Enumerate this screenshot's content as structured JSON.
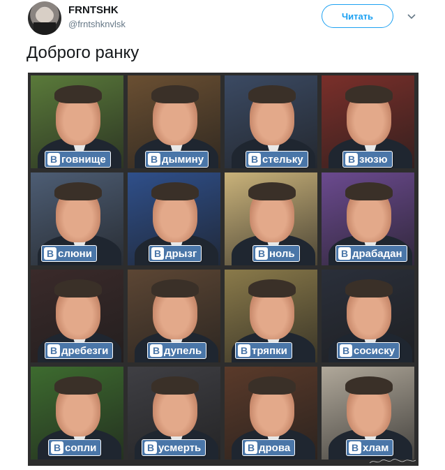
{
  "header": {
    "display_name": "FRNTSHK",
    "handle": "@frntshknvlsk",
    "follow_label": "Читать",
    "icons": {
      "avatar": "profile-photo",
      "menu": "chevron-down-icon"
    }
  },
  "tweet": {
    "text": "Доброго ранку"
  },
  "grid": {
    "badge_letter": "В",
    "badge_color": "#4a76a8",
    "tiles": [
      {
        "label": "говнище",
        "bg": "#5a7a3a"
      },
      {
        "label": "дымину",
        "bg": "#6a4f32"
      },
      {
        "label": "стельку",
        "bg": "#3b4a63"
      },
      {
        "label": "зюзю",
        "bg": "#7a2f2a"
      },
      {
        "label": "слюни",
        "bg": "#4d5d74"
      },
      {
        "label": "дрызг",
        "bg": "#2f4f8a"
      },
      {
        "label": "ноль",
        "bg": "#c9b27a"
      },
      {
        "label": "драбадан",
        "bg": "#6b4a8f"
      },
      {
        "label": "дребезги",
        "bg": "#3a2a2a"
      },
      {
        "label": "дупель",
        "bg": "#5c4634"
      },
      {
        "label": "тряпки",
        "bg": "#8a7a4a"
      },
      {
        "label": "сосиску",
        "bg": "#2a2f3a"
      },
      {
        "label": "сопли",
        "bg": "#3d6b2f"
      },
      {
        "label": "усмерть",
        "bg": "#3f3f44"
      },
      {
        "label": "дрова",
        "bg": "#5a3a2a"
      },
      {
        "label": "хлам",
        "bg": "#b0a89a"
      }
    ],
    "watermark": "Ирина Соболева"
  }
}
